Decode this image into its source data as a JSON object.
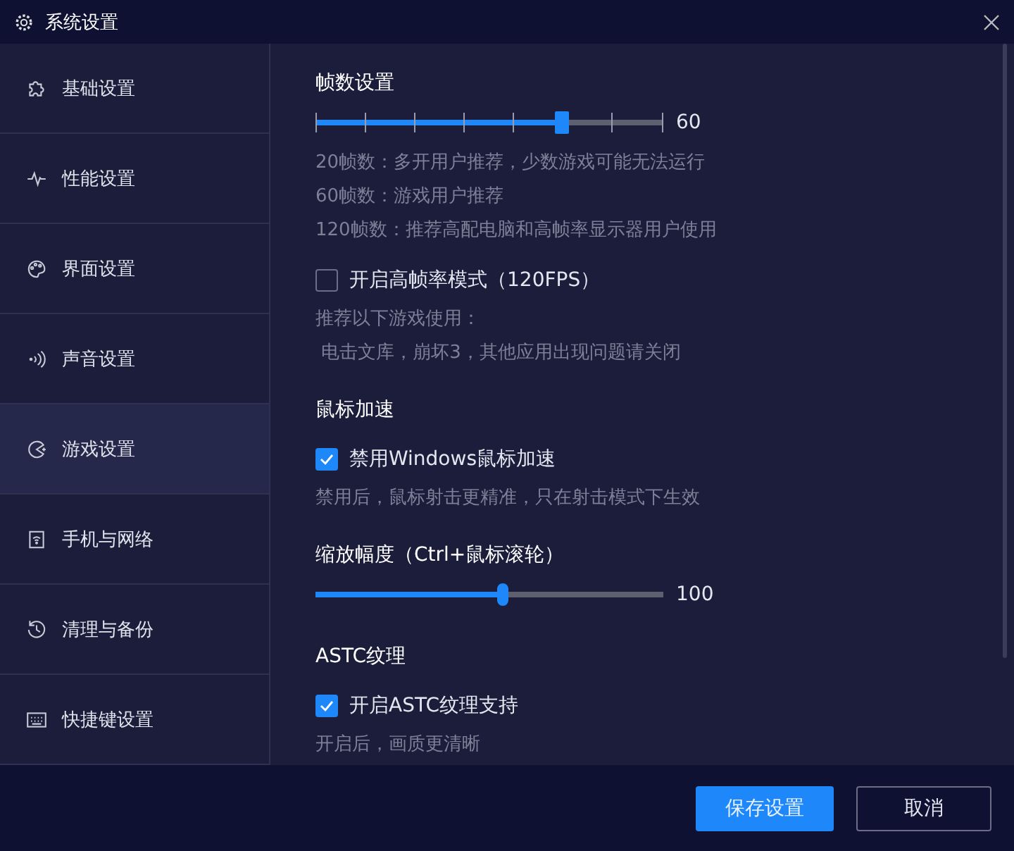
{
  "window": {
    "title": "系统设置"
  },
  "sidebar": {
    "items": [
      {
        "label": "基础设置",
        "selected": false
      },
      {
        "label": "性能设置",
        "selected": false
      },
      {
        "label": "界面设置",
        "selected": false
      },
      {
        "label": "声音设置",
        "selected": false
      },
      {
        "label": "游戏设置",
        "selected": true
      },
      {
        "label": "手机与网络",
        "selected": false
      },
      {
        "label": "清理与备份",
        "selected": false
      },
      {
        "label": "快捷键设置",
        "selected": false
      }
    ]
  },
  "content": [
    {
      "kind": "heading",
      "text": "帧数设置"
    },
    {
      "kind": "step_slider",
      "level": 0.71,
      "reading": "60"
    },
    {
      "kind": "note",
      "text": "20帧数：多开用户推荐，少数游戏可能无法运行"
    },
    {
      "kind": "note",
      "text": "60帧数：游戏用户推荐"
    },
    {
      "kind": "note",
      "text": "120帧数：推荐高配电脑和高帧率显示器用户使用"
    },
    {
      "kind": "checkbox",
      "label": "开启高帧率模式（120FPS）",
      "checked": false
    },
    {
      "kind": "note",
      "text": "推荐以下游戏使用："
    },
    {
      "kind": "note",
      "text": " 电击文库，崩坏3，其他应用出现问题请关闭"
    },
    {
      "kind": "heading",
      "text": "鼠标加速"
    },
    {
      "kind": "checkbox",
      "label": "禁用Windows鼠标加速",
      "checked": true
    },
    {
      "kind": "note",
      "text": "禁用后，鼠标射击更精准，只在射击模式下生效"
    },
    {
      "kind": "heading",
      "text": "缩放幅度（Ctrl+鼠标滚轮）"
    },
    {
      "kind": "slider",
      "level": 0.54,
      "reading": "100"
    },
    {
      "kind": "heading",
      "text": "ASTC纹理"
    },
    {
      "kind": "checkbox",
      "label": "开启ASTC纹理支持",
      "checked": true
    },
    {
      "kind": "note",
      "text": "开启后，画质更清晰"
    }
  ],
  "buttons": [
    {
      "label": "保存设置",
      "kind": "primary"
    },
    {
      "label": "取消",
      "kind": "secondary"
    }
  ]
}
